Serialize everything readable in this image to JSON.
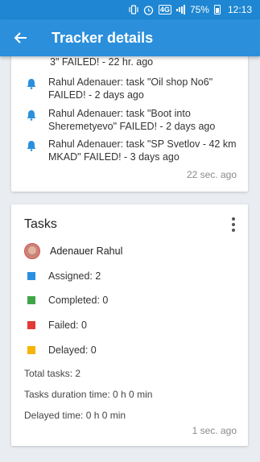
{
  "status_bar": {
    "network": "4G",
    "battery": "75%",
    "time": "12:13"
  },
  "toolbar": {
    "title": "Tracker details",
    "back_icon": "arrow-left-icon"
  },
  "feed": {
    "partial_line": "3\" FAILED! - 22 hr. ago",
    "items": [
      {
        "icon": "bell-icon",
        "text_line1": "Rahul Adenauer:  task \"Oil shop No6\"",
        "text_line2": "FAILED! - 2 days ago"
      },
      {
        "icon": "bell-icon",
        "text_line1": "Rahul Adenauer:  task \"Boot into",
        "text_line2": "Sheremetyevo\" FAILED! - 2 days ago"
      },
      {
        "icon": "bell-icon",
        "text_line1": "Rahul Adenauer:  task \"SP Svetlov - 42 km",
        "text_line2": "MKAD\" FAILED! - 3 days ago"
      }
    ],
    "updated": "22 sec. ago"
  },
  "tasks": {
    "title": "Tasks",
    "assignee": "Adenauer Rahul",
    "stats": [
      {
        "label": "Assigned: 2",
        "color": "#2c8fe0"
      },
      {
        "label": "Completed: 0",
        "color": "#3fa648"
      },
      {
        "label": "Failed: 0",
        "color": "#e53935"
      },
      {
        "label": "Delayed: 0",
        "color": "#f5b400"
      }
    ],
    "total": "Total tasks: 2",
    "duration": "Tasks duration time: 0 h 0 min",
    "delayed_time": "Delayed time: 0 h 0 min",
    "updated": "1 sec. ago"
  }
}
